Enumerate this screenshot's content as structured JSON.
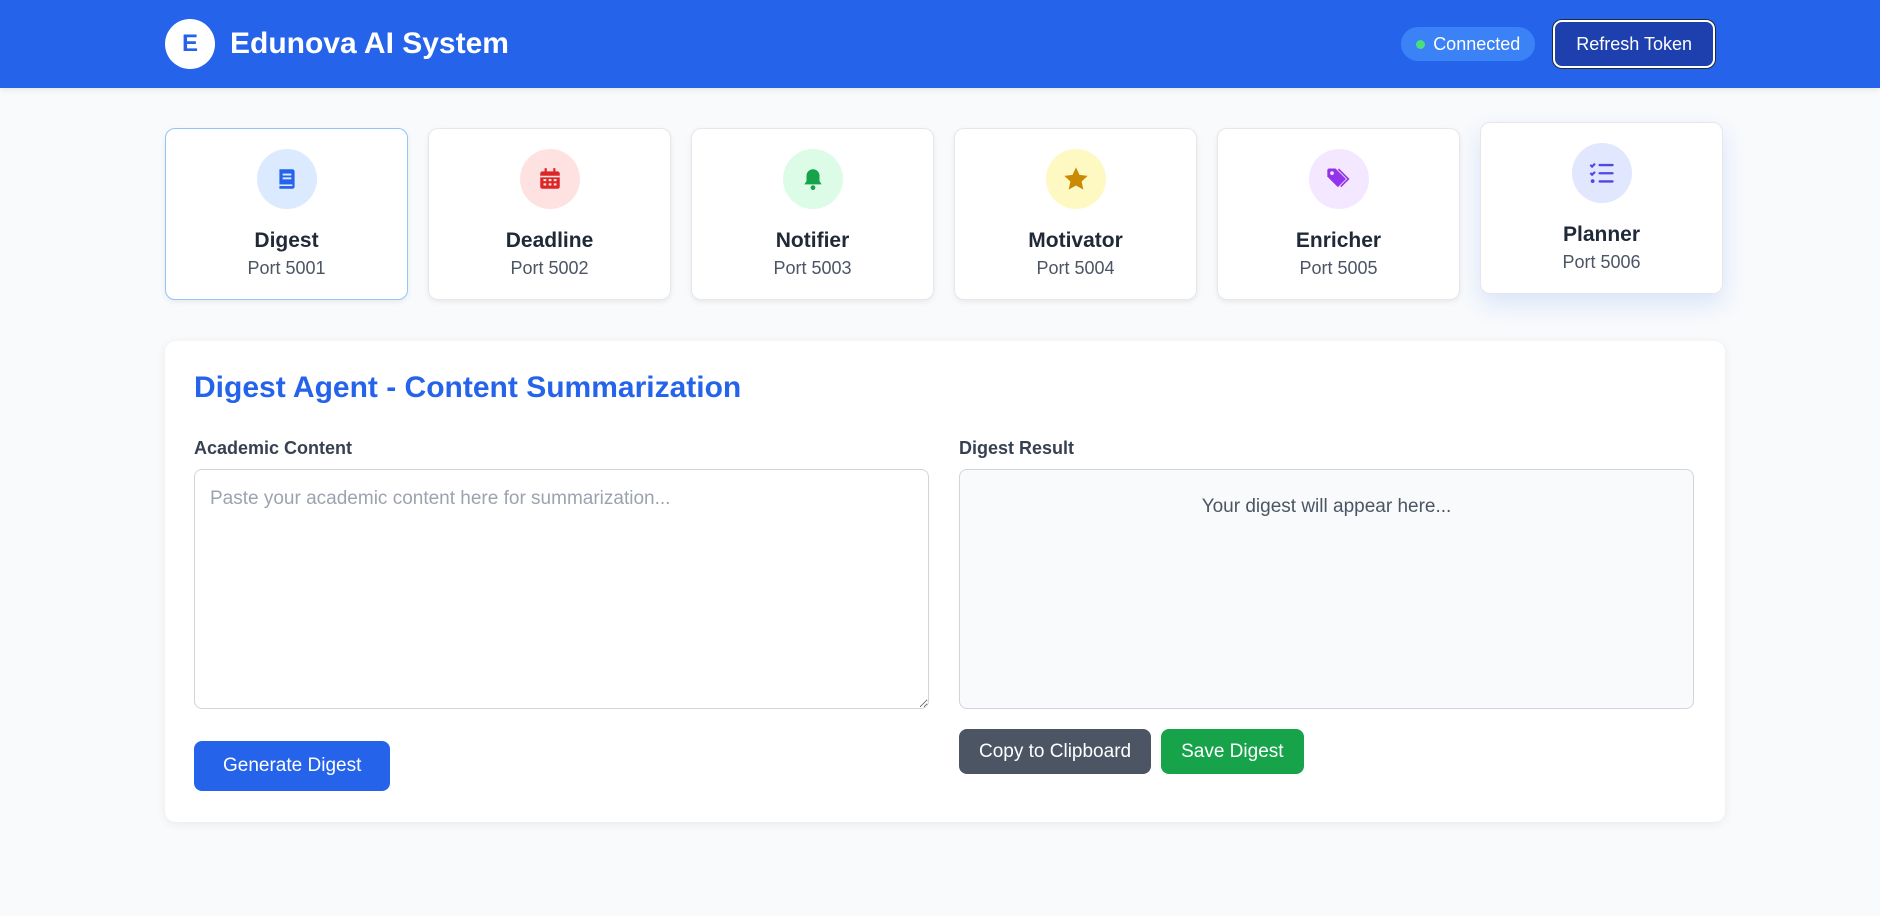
{
  "header": {
    "logo_letter": "E",
    "title": "Edunova AI System",
    "status": "Connected",
    "refresh_label": "Refresh Token"
  },
  "agents": [
    {
      "name": "Digest",
      "port": "Port 5001",
      "icon": "book-icon",
      "icon_color": "#2563eb",
      "bg": "#dbeafe"
    },
    {
      "name": "Deadline",
      "port": "Port 5002",
      "icon": "calendar-icon",
      "icon_color": "#dc2626",
      "bg": "#fee2e2"
    },
    {
      "name": "Notifier",
      "port": "Port 5003",
      "icon": "bell-icon",
      "icon_color": "#16a34a",
      "bg": "#dcfce7"
    },
    {
      "name": "Motivator",
      "port": "Port 5004",
      "icon": "star-icon",
      "icon_color": "#ca8a04",
      "bg": "#fef9c3"
    },
    {
      "name": "Enricher",
      "port": "Port 5005",
      "icon": "tags-icon",
      "icon_color": "#9333ea",
      "bg": "#f3e8ff"
    },
    {
      "name": "Planner",
      "port": "Port 5006",
      "icon": "tasks-icon",
      "icon_color": "#4f46e5",
      "bg": "#e0e7ff"
    }
  ],
  "panel": {
    "title": "Digest Agent - Content Summarization",
    "input_label": "Academic Content",
    "input_placeholder": "Paste your academic content here for summarization...",
    "input_value": "",
    "result_label": "Digest Result",
    "result_placeholder": "Your digest will appear here...",
    "generate_label": "Generate Digest",
    "copy_label": "Copy to Clipboard",
    "save_label": "Save Digest"
  }
}
